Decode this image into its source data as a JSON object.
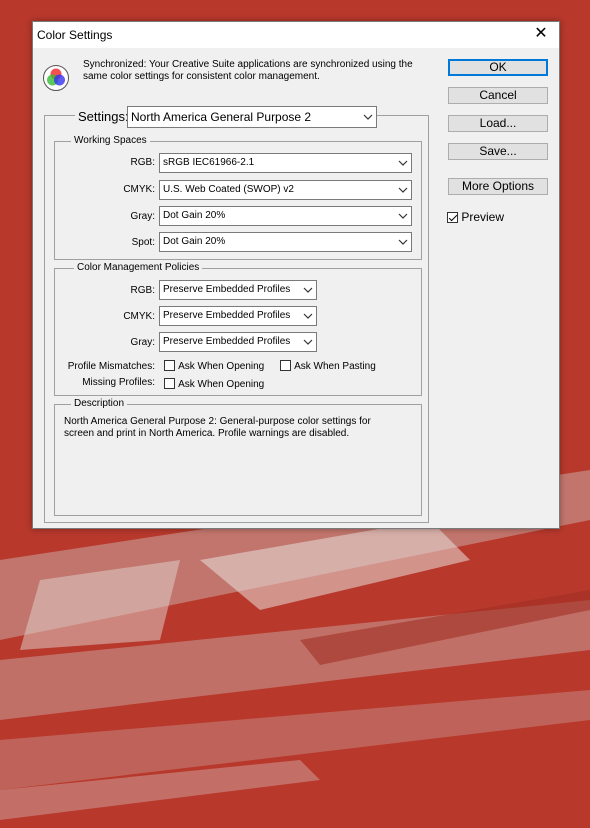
{
  "window": {
    "title": "Color Settings"
  },
  "sync": {
    "text": "Synchronized: Your Creative Suite applications are synchronized using the same color settings for consistent color management."
  },
  "buttons": {
    "ok": "OK",
    "cancel": "Cancel",
    "load": "Load...",
    "save": "Save...",
    "more_options": "More Options"
  },
  "preview": {
    "label": "Preview",
    "checked": true
  },
  "settings": {
    "label": "Settings:",
    "value": "North America General Purpose 2"
  },
  "working_spaces": {
    "legend": "Working Spaces",
    "rgb": {
      "label": "RGB:",
      "value": "sRGB IEC61966-2.1"
    },
    "cmyk": {
      "label": "CMYK:",
      "value": "U.S. Web Coated (SWOP) v2"
    },
    "gray": {
      "label": "Gray:",
      "value": "Dot Gain 20%"
    },
    "spot": {
      "label": "Spot:",
      "value": "Dot Gain 20%"
    }
  },
  "policies": {
    "legend": "Color Management Policies",
    "rgb": {
      "label": "RGB:",
      "value": "Preserve Embedded Profiles"
    },
    "cmyk": {
      "label": "CMYK:",
      "value": "Preserve Embedded Profiles"
    },
    "gray": {
      "label": "Gray:",
      "value": "Preserve Embedded Profiles"
    },
    "profile_mismatches": {
      "label": "Profile Mismatches:",
      "ask_opening": "Ask When Opening",
      "ask_pasting": "Ask When Pasting"
    },
    "missing_profiles": {
      "label": "Missing Profiles:",
      "ask_opening": "Ask When Opening"
    }
  },
  "description": {
    "legend": "Description",
    "text": "North America General Purpose 2:  General-purpose color settings for screen and print in North America. Profile warnings are disabled."
  },
  "colors": {
    "desktop": "#b8382c",
    "dialog": "#f0f0f0",
    "accent": "#0078d7"
  }
}
